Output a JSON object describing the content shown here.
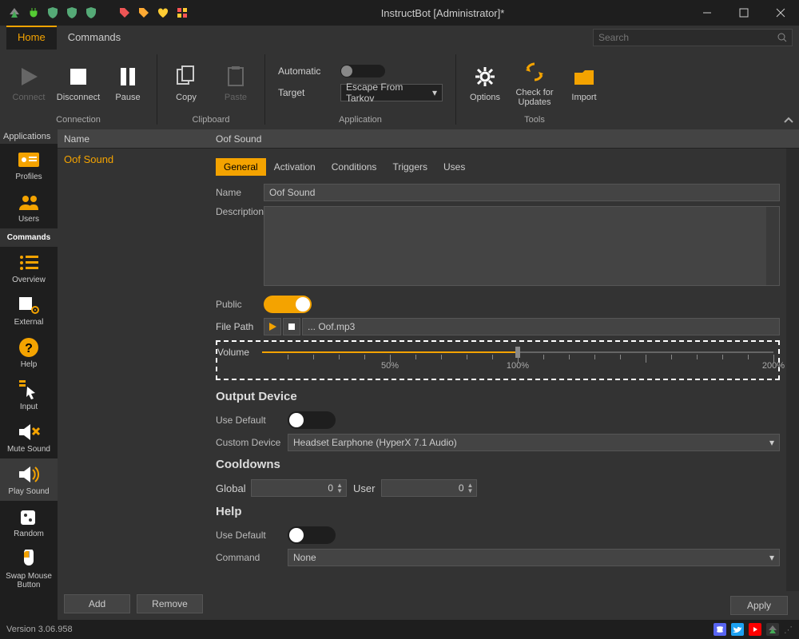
{
  "window": {
    "title": "InstructBot [Administrator]*"
  },
  "menu": {
    "home": "Home",
    "commands": "Commands"
  },
  "search": {
    "placeholder": "Search"
  },
  "ribbon": {
    "connection": {
      "label": "Connection",
      "connect": "Connect",
      "disconnect": "Disconnect",
      "pause": "Pause"
    },
    "clipboard": {
      "label": "Clipboard",
      "copy": "Copy",
      "paste": "Paste"
    },
    "application": {
      "label": "Application",
      "automatic": "Automatic",
      "target_label": "Target",
      "target_value": "Escape From Tarkov"
    },
    "tools": {
      "label": "Tools",
      "options": "Options",
      "check": "Check for Updates",
      "import": "Import"
    }
  },
  "leftnav": {
    "header": "Applications",
    "profiles": "Profiles",
    "users": "Users",
    "commands": "Commands",
    "overview": "Overview",
    "external": "External",
    "help": "Help",
    "input": "Input",
    "mute": "Mute Sound",
    "play": "Play Sound",
    "random": "Random",
    "swap": "Swap Mouse Button"
  },
  "list": {
    "header": "Name",
    "items": [
      "Oof Sound"
    ],
    "add": "Add",
    "remove": "Remove"
  },
  "detail": {
    "title": "Oof Sound",
    "tabs": {
      "general": "General",
      "activation": "Activation",
      "conditions": "Conditions",
      "triggers": "Triggers",
      "uses": "Uses"
    },
    "name_label": "Name",
    "name_value": "Oof Sound",
    "desc_label": "Description",
    "public_label": "Public",
    "filepath_label": "File Path",
    "filepath_value": "...   Oof.mp3",
    "volume_label": "Volume",
    "volume_marks": {
      "m50": "50%",
      "m100": "100%",
      "m200": "200%"
    },
    "output_head": "Output Device",
    "usedefault_label": "Use Default",
    "customdev_label": "Custom Device",
    "customdev_value": "Headset Earphone (HyperX 7.1 Audio)",
    "cooldowns_head": "Cooldowns",
    "global_label": "Global",
    "global_value": "0",
    "user_label": "User",
    "user_value": "0",
    "help_head": "Help",
    "help_usedefault": "Use Default",
    "command_label": "Command",
    "command_value": "None",
    "apply": "Apply"
  },
  "status": {
    "version": "Version 3.06.958"
  }
}
